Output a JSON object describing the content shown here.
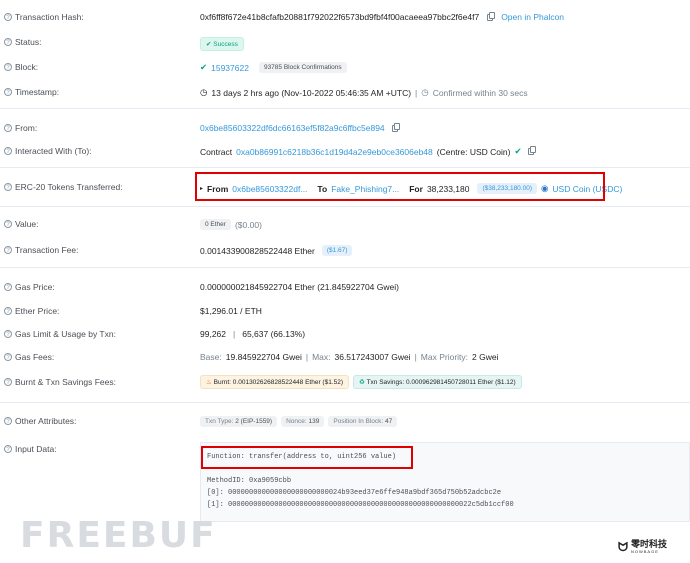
{
  "rows": {
    "tx_hash": {
      "label": "Transaction Hash:",
      "value": "0xf6ff8f672e41b8cfafb20881f792022f6573bd9fbf4f00acaeea97bbc2f6e4f7",
      "action": "Open in Phalcon"
    },
    "status": {
      "label": "Status:",
      "value": "Success"
    },
    "block": {
      "label": "Block:",
      "value": "15937622",
      "confirmations": "93785 Block Confirmations"
    },
    "timestamp": {
      "label": "Timestamp:",
      "value": "13 days 2 hrs ago (Nov-10-2022 05:46:35 AM +UTC)",
      "sep": "|",
      "confirmed": "Confirmed within 30 secs"
    },
    "from": {
      "label": "From:",
      "value": "0x6be85603322df6dc66163ef5f82a9c6ffbc5e894"
    },
    "interacted": {
      "label": "Interacted With (To):",
      "prefix": "Contract",
      "address": "0xa0b86991c6218b36c1d19d4a2e9eb0ce3606eb48",
      "name": "(Centre: USD Coin)"
    },
    "erc20": {
      "label": "ERC-20 Tokens Transferred:",
      "from_label": "From",
      "from": "0x6be85603322df...",
      "to_label": "To",
      "to": "Fake_Phishing7...",
      "for_label": "For",
      "amount": "38,233,180",
      "usd": "($38,233,180.00)",
      "token": "USD Coin (USDC)"
    },
    "value": {
      "label": "Value:",
      "badge": "0 Ether",
      "usd": "($0.00)"
    },
    "fee": {
      "label": "Transaction Fee:",
      "value": "0.001433900828522448 Ether",
      "usd": "($1.67)"
    },
    "gas_price": {
      "label": "Gas Price:",
      "value": "0.000000021845922704 Ether (21.845922704 Gwei)"
    },
    "ether_price": {
      "label": "Ether Price:",
      "value": "$1,296.01 / ETH"
    },
    "gas_limit": {
      "label": "Gas Limit & Usage by Txn:",
      "limit": "99,262",
      "sep": "|",
      "usage": "65,637 (66.13%)"
    },
    "gas_fees": {
      "label": "Gas Fees:",
      "base_label": "Base:",
      "base": "19.845922704 Gwei",
      "sep1": "|",
      "max_label": "Max:",
      "max": "36.517243007 Gwei",
      "sep2": "|",
      "prio_label": "Max Priority:",
      "prio": "2 Gwei"
    },
    "burnt": {
      "label": "Burnt & Txn Savings Fees:",
      "burnt_label": "Burnt:",
      "burnt": "0.001302626828522448 Ether ($1.52)",
      "savings_label": "Txn Savings:",
      "savings": "0.000962981450728011 Ether ($1.12)"
    },
    "other": {
      "label": "Other Attributes:",
      "txn_type_label": "Txn Type:",
      "txn_type": "2 (EIP-1559)",
      "nonce_label": "Nonce:",
      "nonce": "139",
      "position_label": "Position In Block:",
      "position": "47"
    },
    "input": {
      "label": "Input Data:",
      "function": "Function: transfer(address to, uint256 value)",
      "method": "MethodID: 0xa9059cbb",
      "p0": "[0]:  000000000000000000000000024b93eed37e6ffe948a9bdf365d750b52adcbc2e",
      "p1": "[1]:  0000000000000000000000000000000000000000000000000000000022c5db1ccf00"
    }
  },
  "watermark": "FREEBUF",
  "logo": {
    "title": "零时科技",
    "sub": "NOWBAGE"
  },
  "colors": {
    "link": "#3498db",
    "success": "#00a186",
    "highlight": "#e00000"
  }
}
